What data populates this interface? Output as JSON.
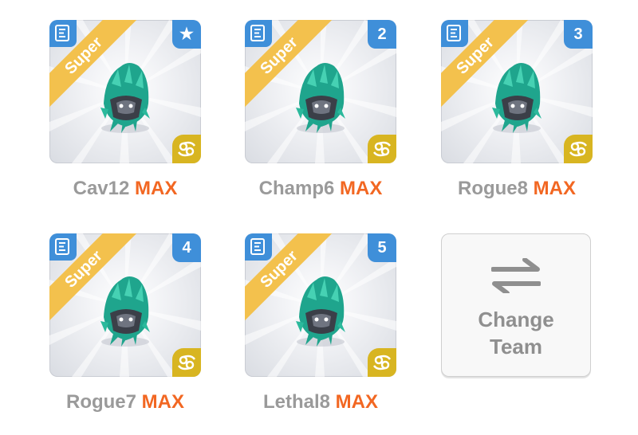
{
  "team": [
    {
      "name": "Cav12",
      "level": "MAX",
      "rarity": "Super",
      "badge": "★",
      "badge_icon": "star-icon",
      "element_icon": "cancer-zodiac-icon"
    },
    {
      "name": "Champ6",
      "level": "MAX",
      "rarity": "Super",
      "badge": "2",
      "element_icon": "cancer-zodiac-icon"
    },
    {
      "name": "Rogue8",
      "level": "MAX",
      "rarity": "Super",
      "badge": "3",
      "element_icon": "cancer-zodiac-icon"
    },
    {
      "name": "Rogue7",
      "level": "MAX",
      "rarity": "Super",
      "badge": "4",
      "element_icon": "cancer-zodiac-icon"
    },
    {
      "name": "Lethal8",
      "level": "MAX",
      "rarity": "Super",
      "badge": "5",
      "element_icon": "cancer-zodiac-icon"
    }
  ],
  "change_team": {
    "line1": "Change",
    "line2": "Team",
    "icon": "swap-arrows-icon"
  },
  "colors": {
    "badge_blue": "#3f8fd9",
    "ribbon_gold": "#f3c14d",
    "element_gold": "#d8b521",
    "max_orange": "#f26722",
    "name_gray": "#9a9a9a",
    "monster_teal": "#1fa58d"
  }
}
